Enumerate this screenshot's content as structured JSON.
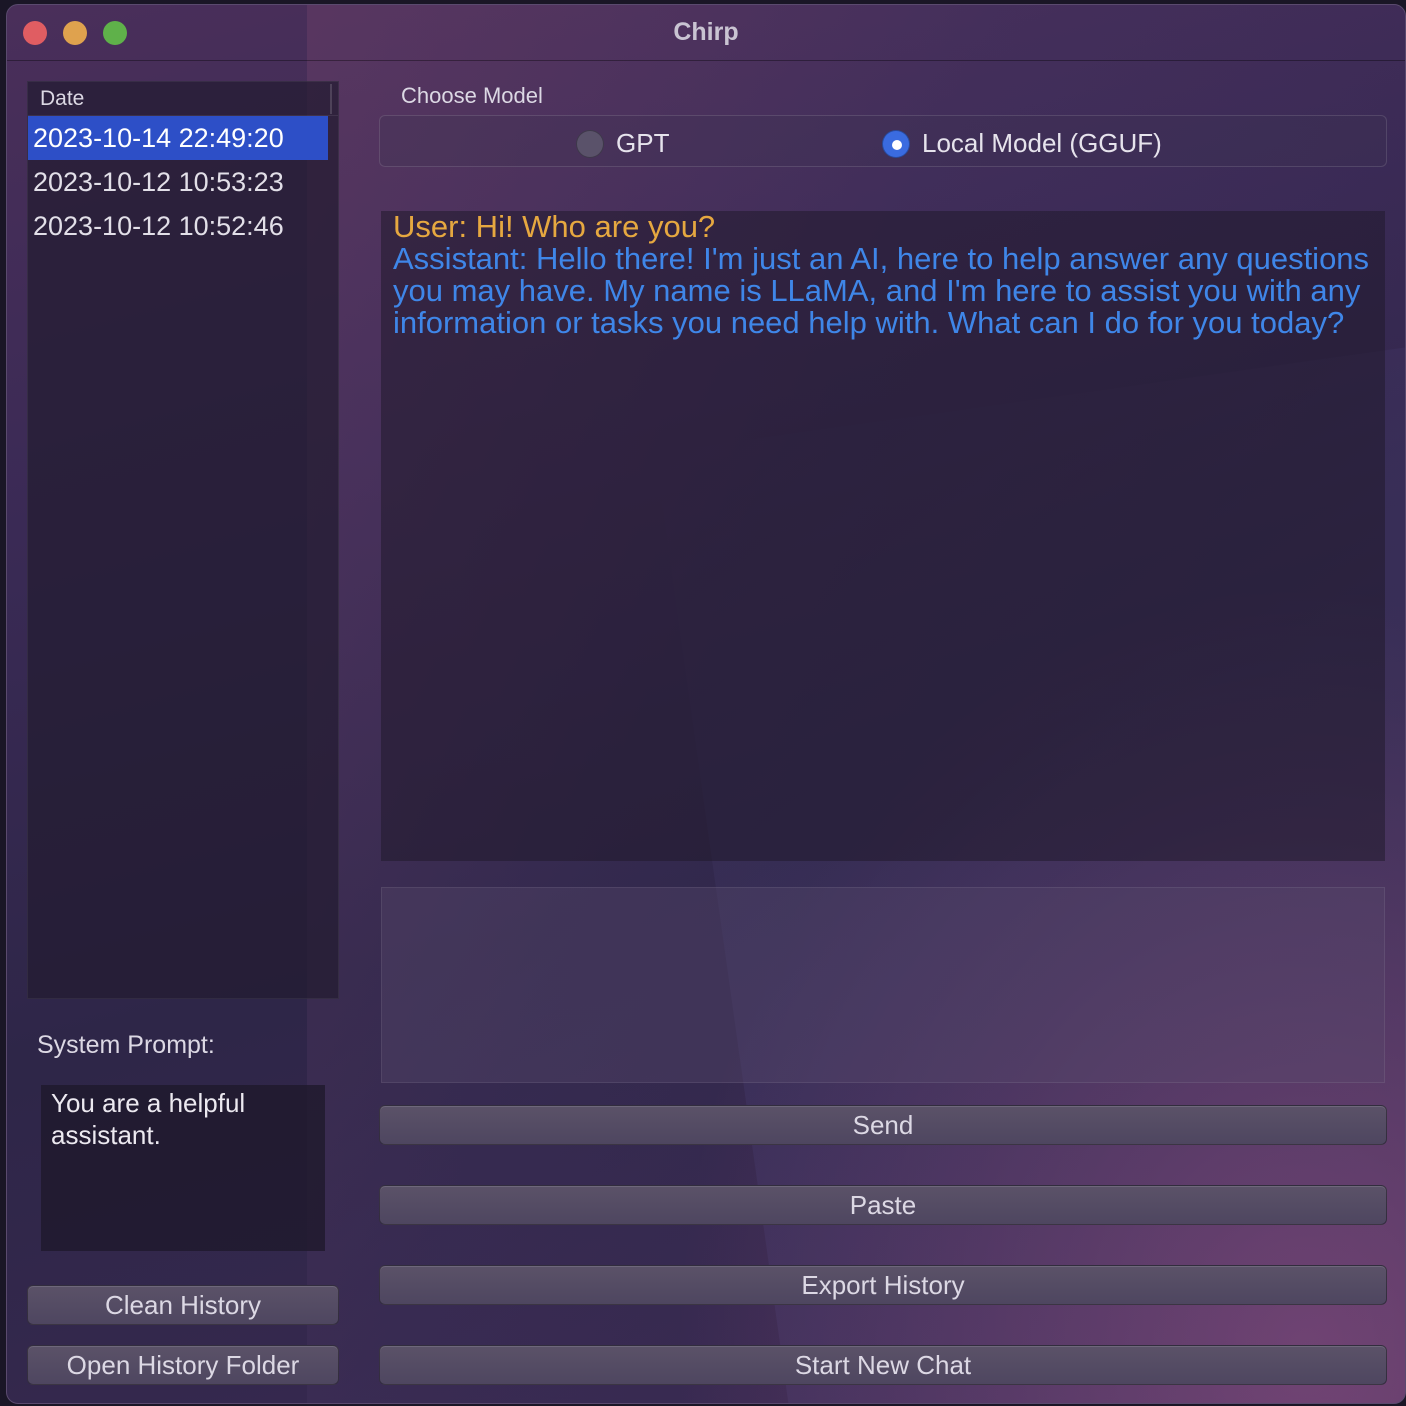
{
  "window": {
    "title": "Chirp"
  },
  "history": {
    "column_header": "Date",
    "items": [
      {
        "label": "2023-10-14 22:49:20",
        "selected": true
      },
      {
        "label": "2023-10-12 10:53:23",
        "selected": false
      },
      {
        "label": "2023-10-12 10:52:46",
        "selected": false
      }
    ]
  },
  "system_prompt": {
    "label": "System Prompt:",
    "value": "You are a helpful assistant."
  },
  "left_buttons": {
    "clean_history": "Clean History",
    "open_history_folder": "Open History Folder"
  },
  "model_chooser": {
    "label": "Choose Model",
    "options": [
      {
        "label": "GPT",
        "selected": false
      },
      {
        "label": "Local Model (GGUF)",
        "selected": true
      }
    ]
  },
  "chat": {
    "user_message": "User: Hi! Who are you?",
    "assistant_message": "Assistant:  Hello there! I'm just an AI, here to help answer any questions you may have. My name is LLaMA, and I'm here to assist you with any information or tasks you need help with. What can I do for you today?"
  },
  "message_input": {
    "value": ""
  },
  "right_buttons": {
    "send": "Send",
    "paste": "Paste",
    "export_history": "Export History",
    "start_new_chat": "Start New Chat"
  },
  "colors": {
    "user_text": "#e6a840",
    "assistant_text": "#3f86e8",
    "selection": "#2d4fc7",
    "radio_selected": "#3a6be0"
  }
}
